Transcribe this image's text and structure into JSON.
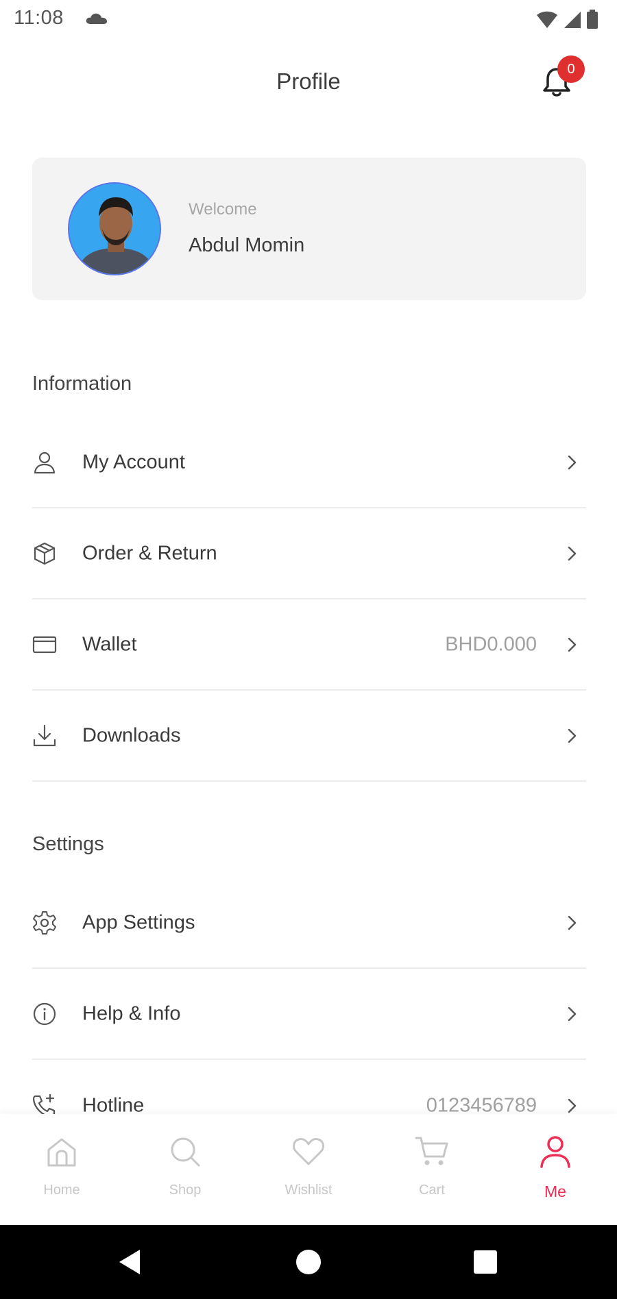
{
  "status_bar": {
    "time": "11:08",
    "icons": [
      "cloud-icon",
      "wifi-icon",
      "signal-icon",
      "battery-icon"
    ]
  },
  "header": {
    "title": "Profile",
    "notification_count": "0"
  },
  "profile": {
    "welcome": "Welcome",
    "name": "Abdul Momin"
  },
  "information": {
    "title": "Information",
    "items": [
      {
        "label": "My Account",
        "icon": "user-icon",
        "value": ""
      },
      {
        "label": "Order & Return",
        "icon": "box-icon",
        "value": ""
      },
      {
        "label": "Wallet",
        "icon": "card-icon",
        "value": "BHD0.000"
      },
      {
        "label": "Downloads",
        "icon": "download-icon",
        "value": ""
      }
    ]
  },
  "settings": {
    "title": "Settings",
    "items": [
      {
        "label": "App Settings",
        "icon": "gear-icon",
        "value": ""
      },
      {
        "label": "Help & Info",
        "icon": "info-icon",
        "value": ""
      },
      {
        "label": "Hotline",
        "icon": "phone-icon",
        "value": "0123456789"
      }
    ]
  },
  "bottom_nav": {
    "items": [
      {
        "label": "Home",
        "icon": "home-icon"
      },
      {
        "label": "Shop",
        "icon": "search-icon"
      },
      {
        "label": "Wishlist",
        "icon": "heart-icon"
      },
      {
        "label": "Cart",
        "icon": "cart-icon"
      },
      {
        "label": "Me",
        "icon": "person-icon"
      }
    ],
    "active": "Me"
  },
  "colors": {
    "accent": "#ee2d55",
    "badge": "#e02f2f",
    "card_bg": "#f3f3f3",
    "avatar_bg": "#38a5f0"
  }
}
